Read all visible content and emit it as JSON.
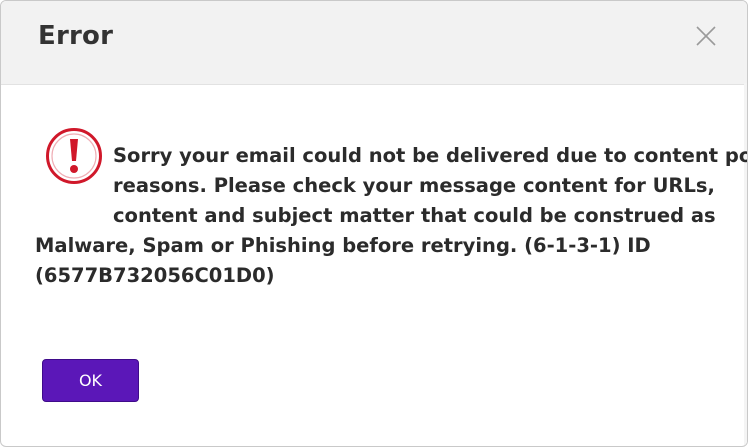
{
  "dialog": {
    "title": "Error",
    "close_icon": "close-icon",
    "status_icon": "exclamation-circle-icon",
    "status_color": "#d0182a",
    "message_lines": [
      "Sorry your email could not be delivered due to content policy",
      "reasons. Please check your message content for URLs,",
      "content and subject matter that could be construed as",
      "Malware, Spam or Phishing before retrying. (6-1-3-1) ID",
      "(6577B732056C01D0)"
    ],
    "ok_label": "OK",
    "ok_color": "#5b17b8"
  }
}
